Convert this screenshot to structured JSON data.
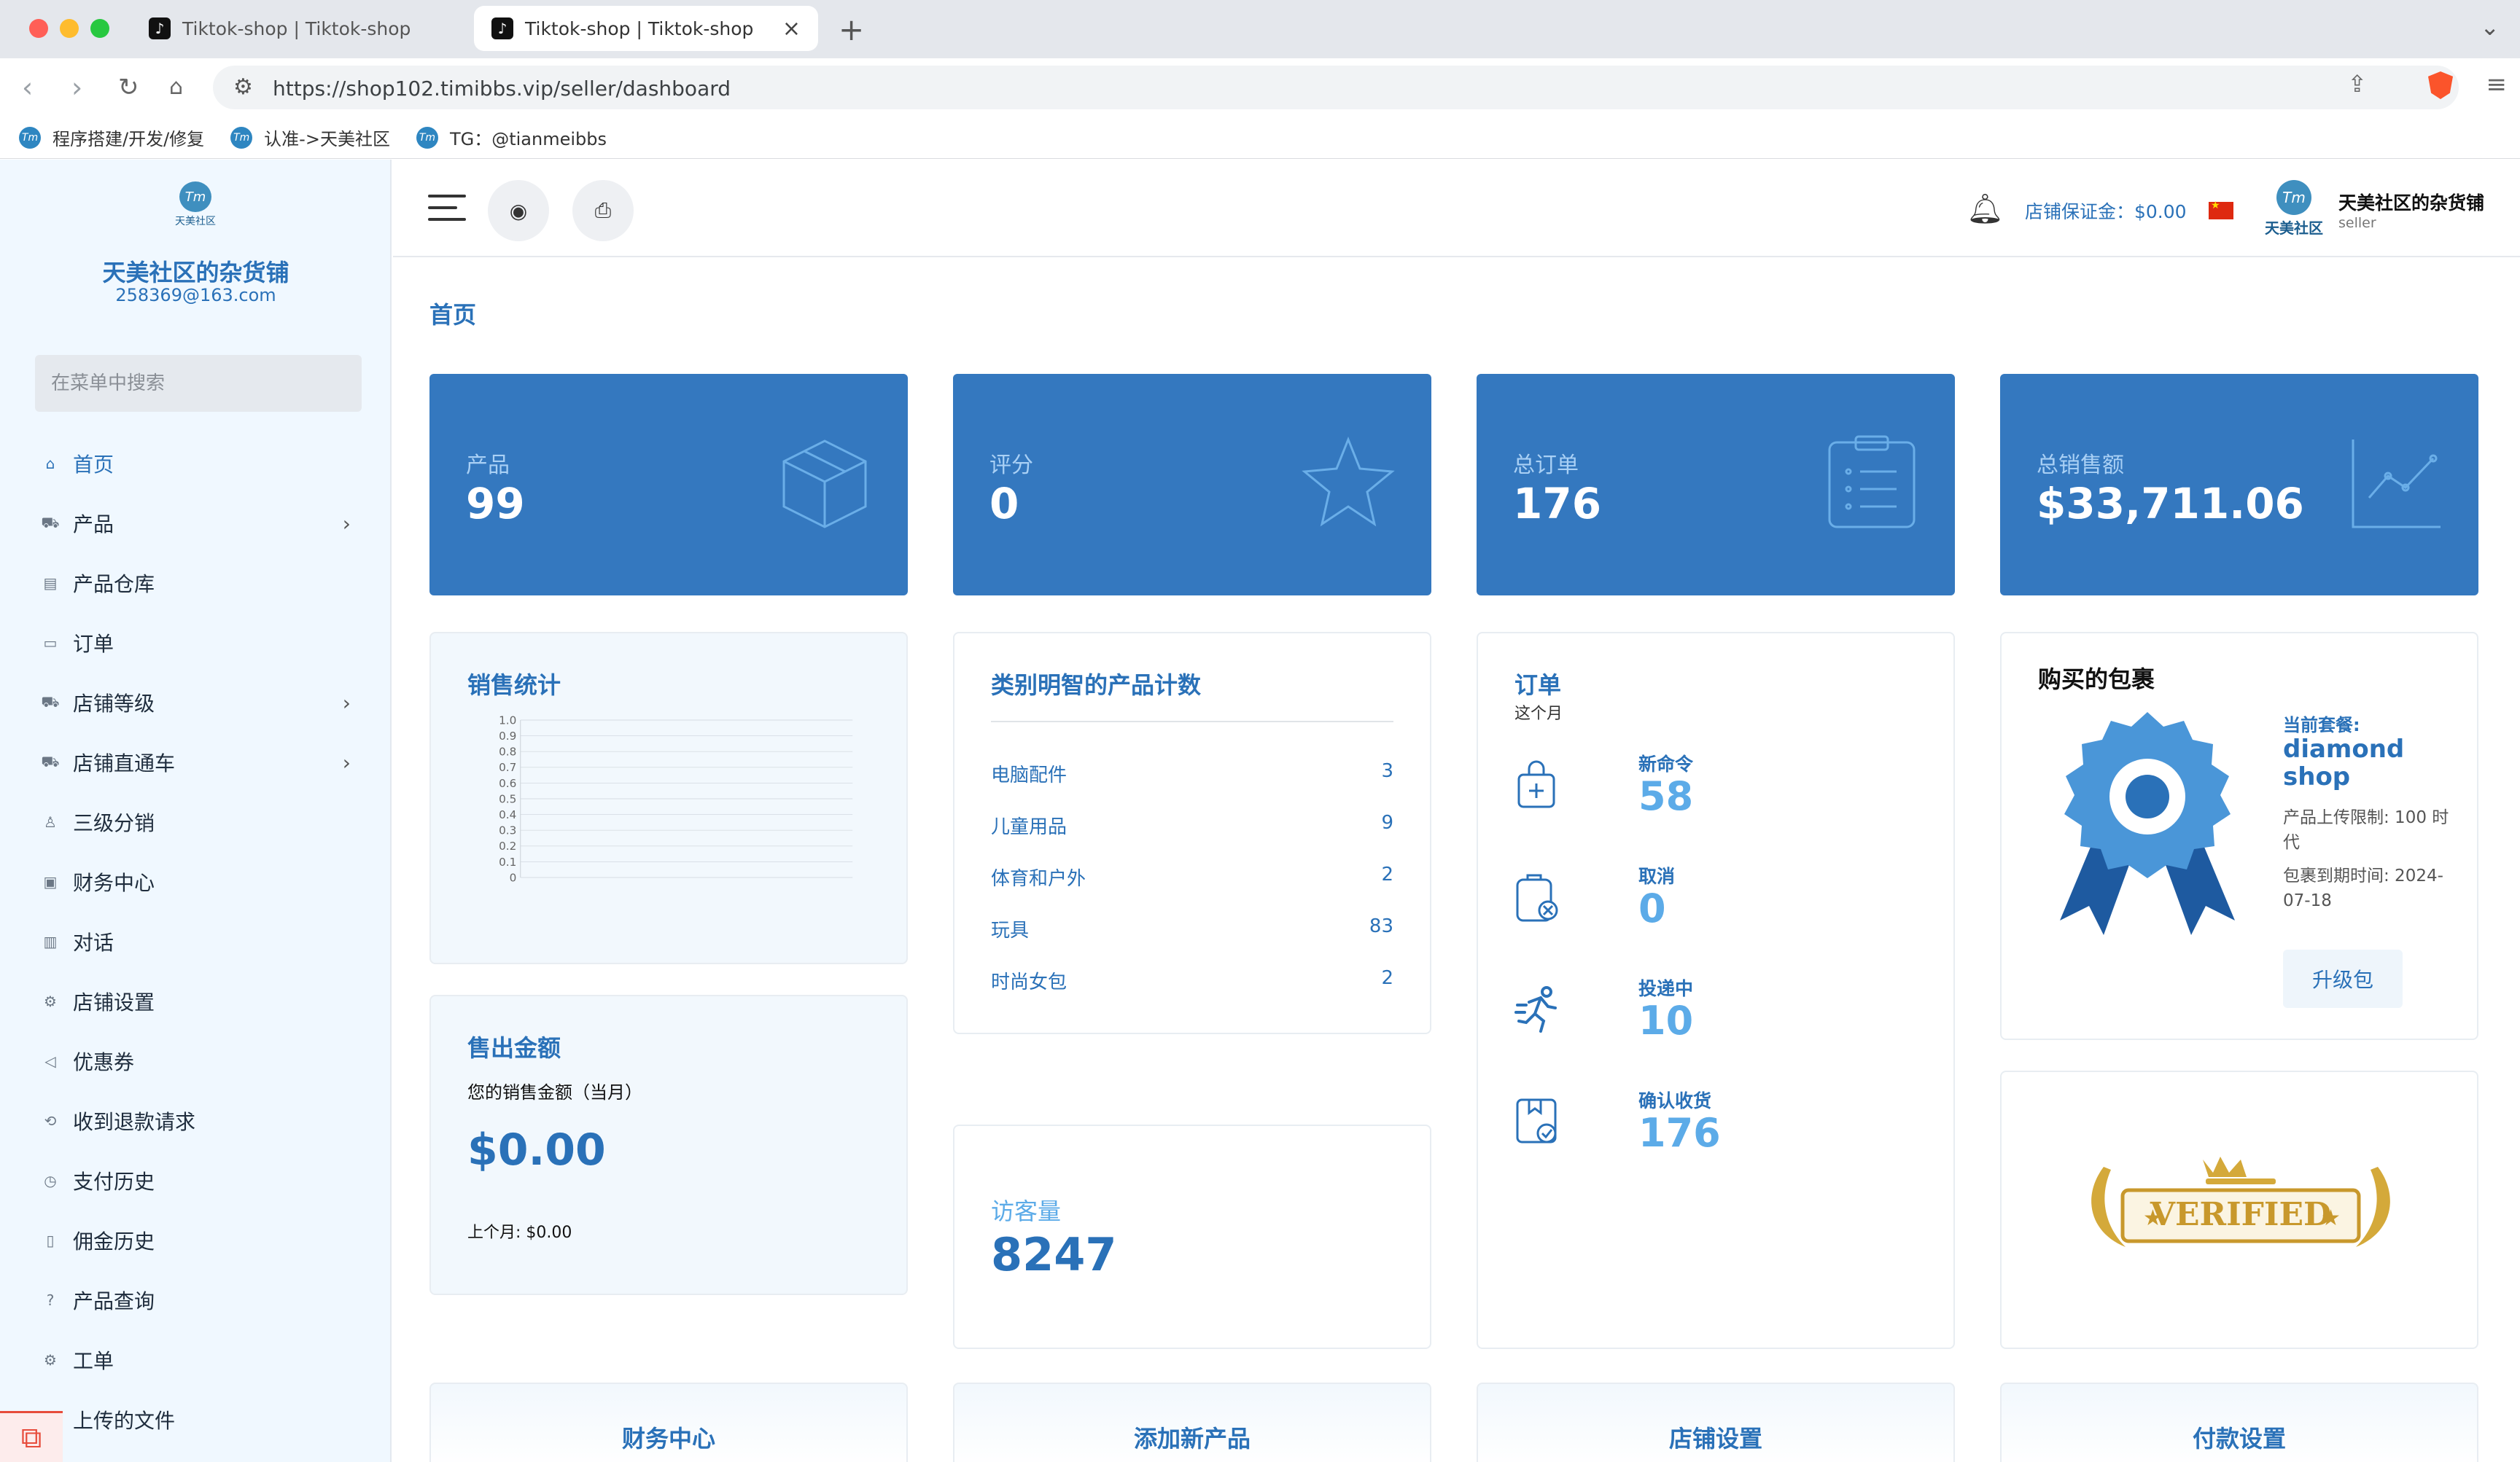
{
  "browser": {
    "tabs": [
      {
        "title": "Tiktok-shop | Tiktok-shop"
      },
      {
        "title": "Tiktok-shop | Tiktok-shop"
      }
    ],
    "url": "https://shop102.timibbs.vip/seller/dashboard",
    "bookmarks": [
      {
        "label": "程序搭建/开发/修复",
        "logo": "Tm"
      },
      {
        "label": "认准->天美社区",
        "logo": "Tm"
      },
      {
        "label": "TG：@tianmeibbs",
        "logo": "Tm"
      }
    ]
  },
  "sidebar": {
    "logo_sub": "天美社区",
    "logo_text": "Tm",
    "shop_name": "天美社区的杂货铺",
    "email": "258369@163.com",
    "search_placeholder": "在菜单中搜索",
    "items": [
      {
        "label": "首页",
        "icon": "home-icon"
      },
      {
        "label": "产品",
        "icon": "cart-icon",
        "chevron": "›"
      },
      {
        "label": "产品仓库",
        "icon": "warehouse-icon"
      },
      {
        "label": "订单",
        "icon": "order-icon"
      },
      {
        "label": "店铺等级",
        "icon": "cart-icon",
        "chevron": "›"
      },
      {
        "label": "店铺直通车",
        "icon": "cart-icon",
        "chevron": "›"
      },
      {
        "label": "三级分销",
        "icon": "user-icon"
      },
      {
        "label": "财务中心",
        "icon": "wallet-icon"
      },
      {
        "label": "对话",
        "icon": "chat-icon"
      },
      {
        "label": "店铺设置",
        "icon": "gear-icon"
      },
      {
        "label": "优惠券",
        "icon": "megaphone-icon"
      },
      {
        "label": "收到退款请求",
        "icon": "refund-icon"
      },
      {
        "label": "支付历史",
        "icon": "history-icon"
      },
      {
        "label": "佣金历史",
        "icon": "document-icon"
      },
      {
        "label": "产品查询",
        "icon": "question-icon"
      },
      {
        "label": "工单",
        "icon": "gear-icon"
      },
      {
        "label": "上传的文件",
        "icon": "upload-icon"
      }
    ]
  },
  "header": {
    "deposit": "店铺保证金：$0.00",
    "logo_text": "Tm",
    "logo_sub": "天美社区",
    "user_name": "天美社区的杂货铺",
    "user_role": "seller"
  },
  "page": {
    "title": "首页"
  },
  "stats": [
    {
      "label": "产品",
      "value": "99",
      "icon": "box-icon"
    },
    {
      "label": "评分",
      "value": "0",
      "icon": "star-icon"
    },
    {
      "label": "总订单",
      "value": "176",
      "icon": "clipboard-icon"
    },
    {
      "label": "总销售额",
      "value": "$33,711.06",
      "icon": "trend-icon"
    }
  ],
  "sales_stats": {
    "title": "销售统计",
    "y_ticks": [
      "1.0",
      "0.9",
      "0.8",
      "0.7",
      "0.6",
      "0.5",
      "0.4",
      "0.3",
      "0.2",
      "0.1",
      "0"
    ]
  },
  "chart_data": {
    "type": "line",
    "title": "销售统计",
    "ylim": [
      0,
      1.0
    ],
    "y_ticks": [
      0,
      0.1,
      0.2,
      0.3,
      0.4,
      0.5,
      0.6,
      0.7,
      0.8,
      0.9,
      1.0
    ],
    "series": [],
    "grid": true
  },
  "category_counts": {
    "title": "类别明智的产品计数",
    "rows": [
      {
        "name": "电脑配件",
        "count": "3"
      },
      {
        "name": "儿童用品",
        "count": "9"
      },
      {
        "name": "体育和户外",
        "count": "2"
      },
      {
        "name": "玩具",
        "count": "83"
      },
      {
        "name": "时尚女包",
        "count": "2"
      }
    ]
  },
  "orders": {
    "title": "订单",
    "subtitle": "这个月",
    "items": [
      {
        "label": "新命令",
        "value": "58",
        "icon": "bag-plus-icon"
      },
      {
        "label": "取消",
        "value": "0",
        "icon": "cancel-icon"
      },
      {
        "label": "投递中",
        "value": "10",
        "icon": "runner-icon"
      },
      {
        "label": "确认收货",
        "value": "176",
        "icon": "received-icon"
      }
    ]
  },
  "package": {
    "title": "购买的包裹",
    "current_label": "当前套餐:",
    "name": "diamond shop",
    "upload_limit": "产品上传限制: 100 时代",
    "expiry": "包裹到期时间: 2024-07-18",
    "upgrade": "升级包"
  },
  "sold": {
    "title": "售出金额",
    "subtitle": "您的销售金额（当月）",
    "value": "$0.00",
    "last_month": "上个月: $0.00"
  },
  "visitors": {
    "label": "访客量",
    "value": "8247"
  },
  "verified": {
    "text": "VERIFIED"
  },
  "quick_links": [
    "财务中心",
    "添加新产品",
    "店铺设置",
    "付款设置"
  ]
}
